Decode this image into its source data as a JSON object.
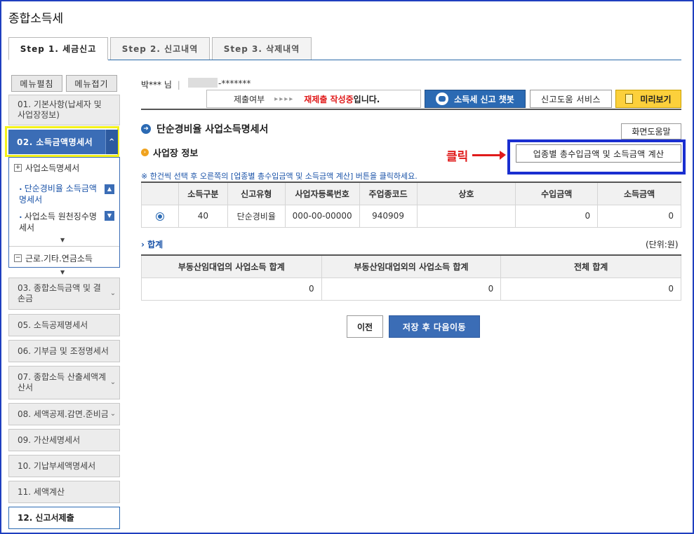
{
  "page": {
    "title": "종합소득세"
  },
  "tabs": [
    {
      "label": "Step 1. 세금신고"
    },
    {
      "label": "Step 2. 신고내역"
    },
    {
      "label": "Step 3. 삭제내역"
    }
  ],
  "sidebar": {
    "expand_label": "메뉴펼침",
    "collapse_label": "메뉴접기",
    "items": {
      "m01": "01. 기본사항(납세자 및 사업장정보)",
      "m02": "02. 소득금액명세서",
      "m03": "03. 종합소득금액 및 결손금",
      "m05": "05. 소득공제명세서",
      "m06": "06. 기부금 및 조정명세서",
      "m07": "07. 종합소득 산출세액계산서",
      "m08": "08. 세액공제.감면.준비금",
      "m09": "09. 가산세명세서",
      "m10": "10. 기납부세액명세서",
      "m11": "11. 세액계산",
      "m12": "12. 신고서제출"
    },
    "sub": {
      "business": "사업소득명세서",
      "simple": "단순경비율 소득금액명세서",
      "withholding": "사업소득 원천징수명세서",
      "labor": "근로.기타.연금소득"
    }
  },
  "header": {
    "user_name": "박*** 님",
    "user_id_tail": "-*******",
    "status_label": "제출여부",
    "status_arrows": "▸▸▸▸",
    "status_red": "재제출 작성중",
    "status_suffix": "입니다.",
    "chatbot": "소득세 신고 챗봇",
    "help_service": "신고도움 서비스",
    "preview": "미리보기"
  },
  "section": {
    "title": "단순경비율 사업소득명세서",
    "screen_help": "화면도움말",
    "subtitle": "사업장 정보",
    "calc_button": "업종별 총수입금액 및 소득금액 계산",
    "click_label": "클릭",
    "notice": "※ 한건씩 선택 후 오른쪽의 [업종별 총수입금액 및 소득금액 계산] 버튼을 클릭하세요."
  },
  "table1": {
    "headers": [
      "소득구분",
      "신고유형",
      "사업자등록번호",
      "주업종코드",
      "상호",
      "수입금액",
      "소득금액"
    ],
    "row": {
      "income_type": "40",
      "report_type": "단순경비율",
      "biz_no": "000-00-00000",
      "code": "940909",
      "name": "",
      "revenue": "0",
      "income": "0"
    }
  },
  "summary": {
    "label": "› 합계",
    "unit": "(단위:원)",
    "headers": [
      "부동산임대업의 사업소득 합계",
      "부동산임대업외의 사업소득 합계",
      "전체 합계"
    ],
    "values": [
      "0",
      "0",
      "0"
    ]
  },
  "footer": {
    "prev": "이전",
    "next": "저장 후 다음이동"
  }
}
